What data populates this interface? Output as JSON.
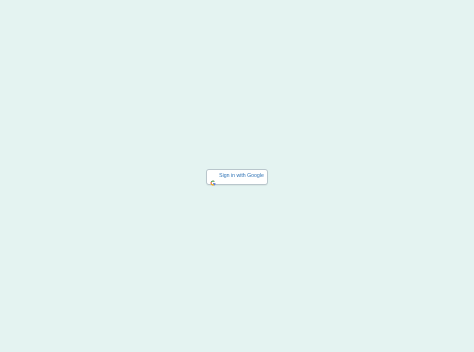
{
  "page": {
    "background_color": "#e4f3f1"
  },
  "signin": {
    "label": "Sign in with Google",
    "icon": "google-g-icon",
    "text_color": "#2f73b6"
  }
}
